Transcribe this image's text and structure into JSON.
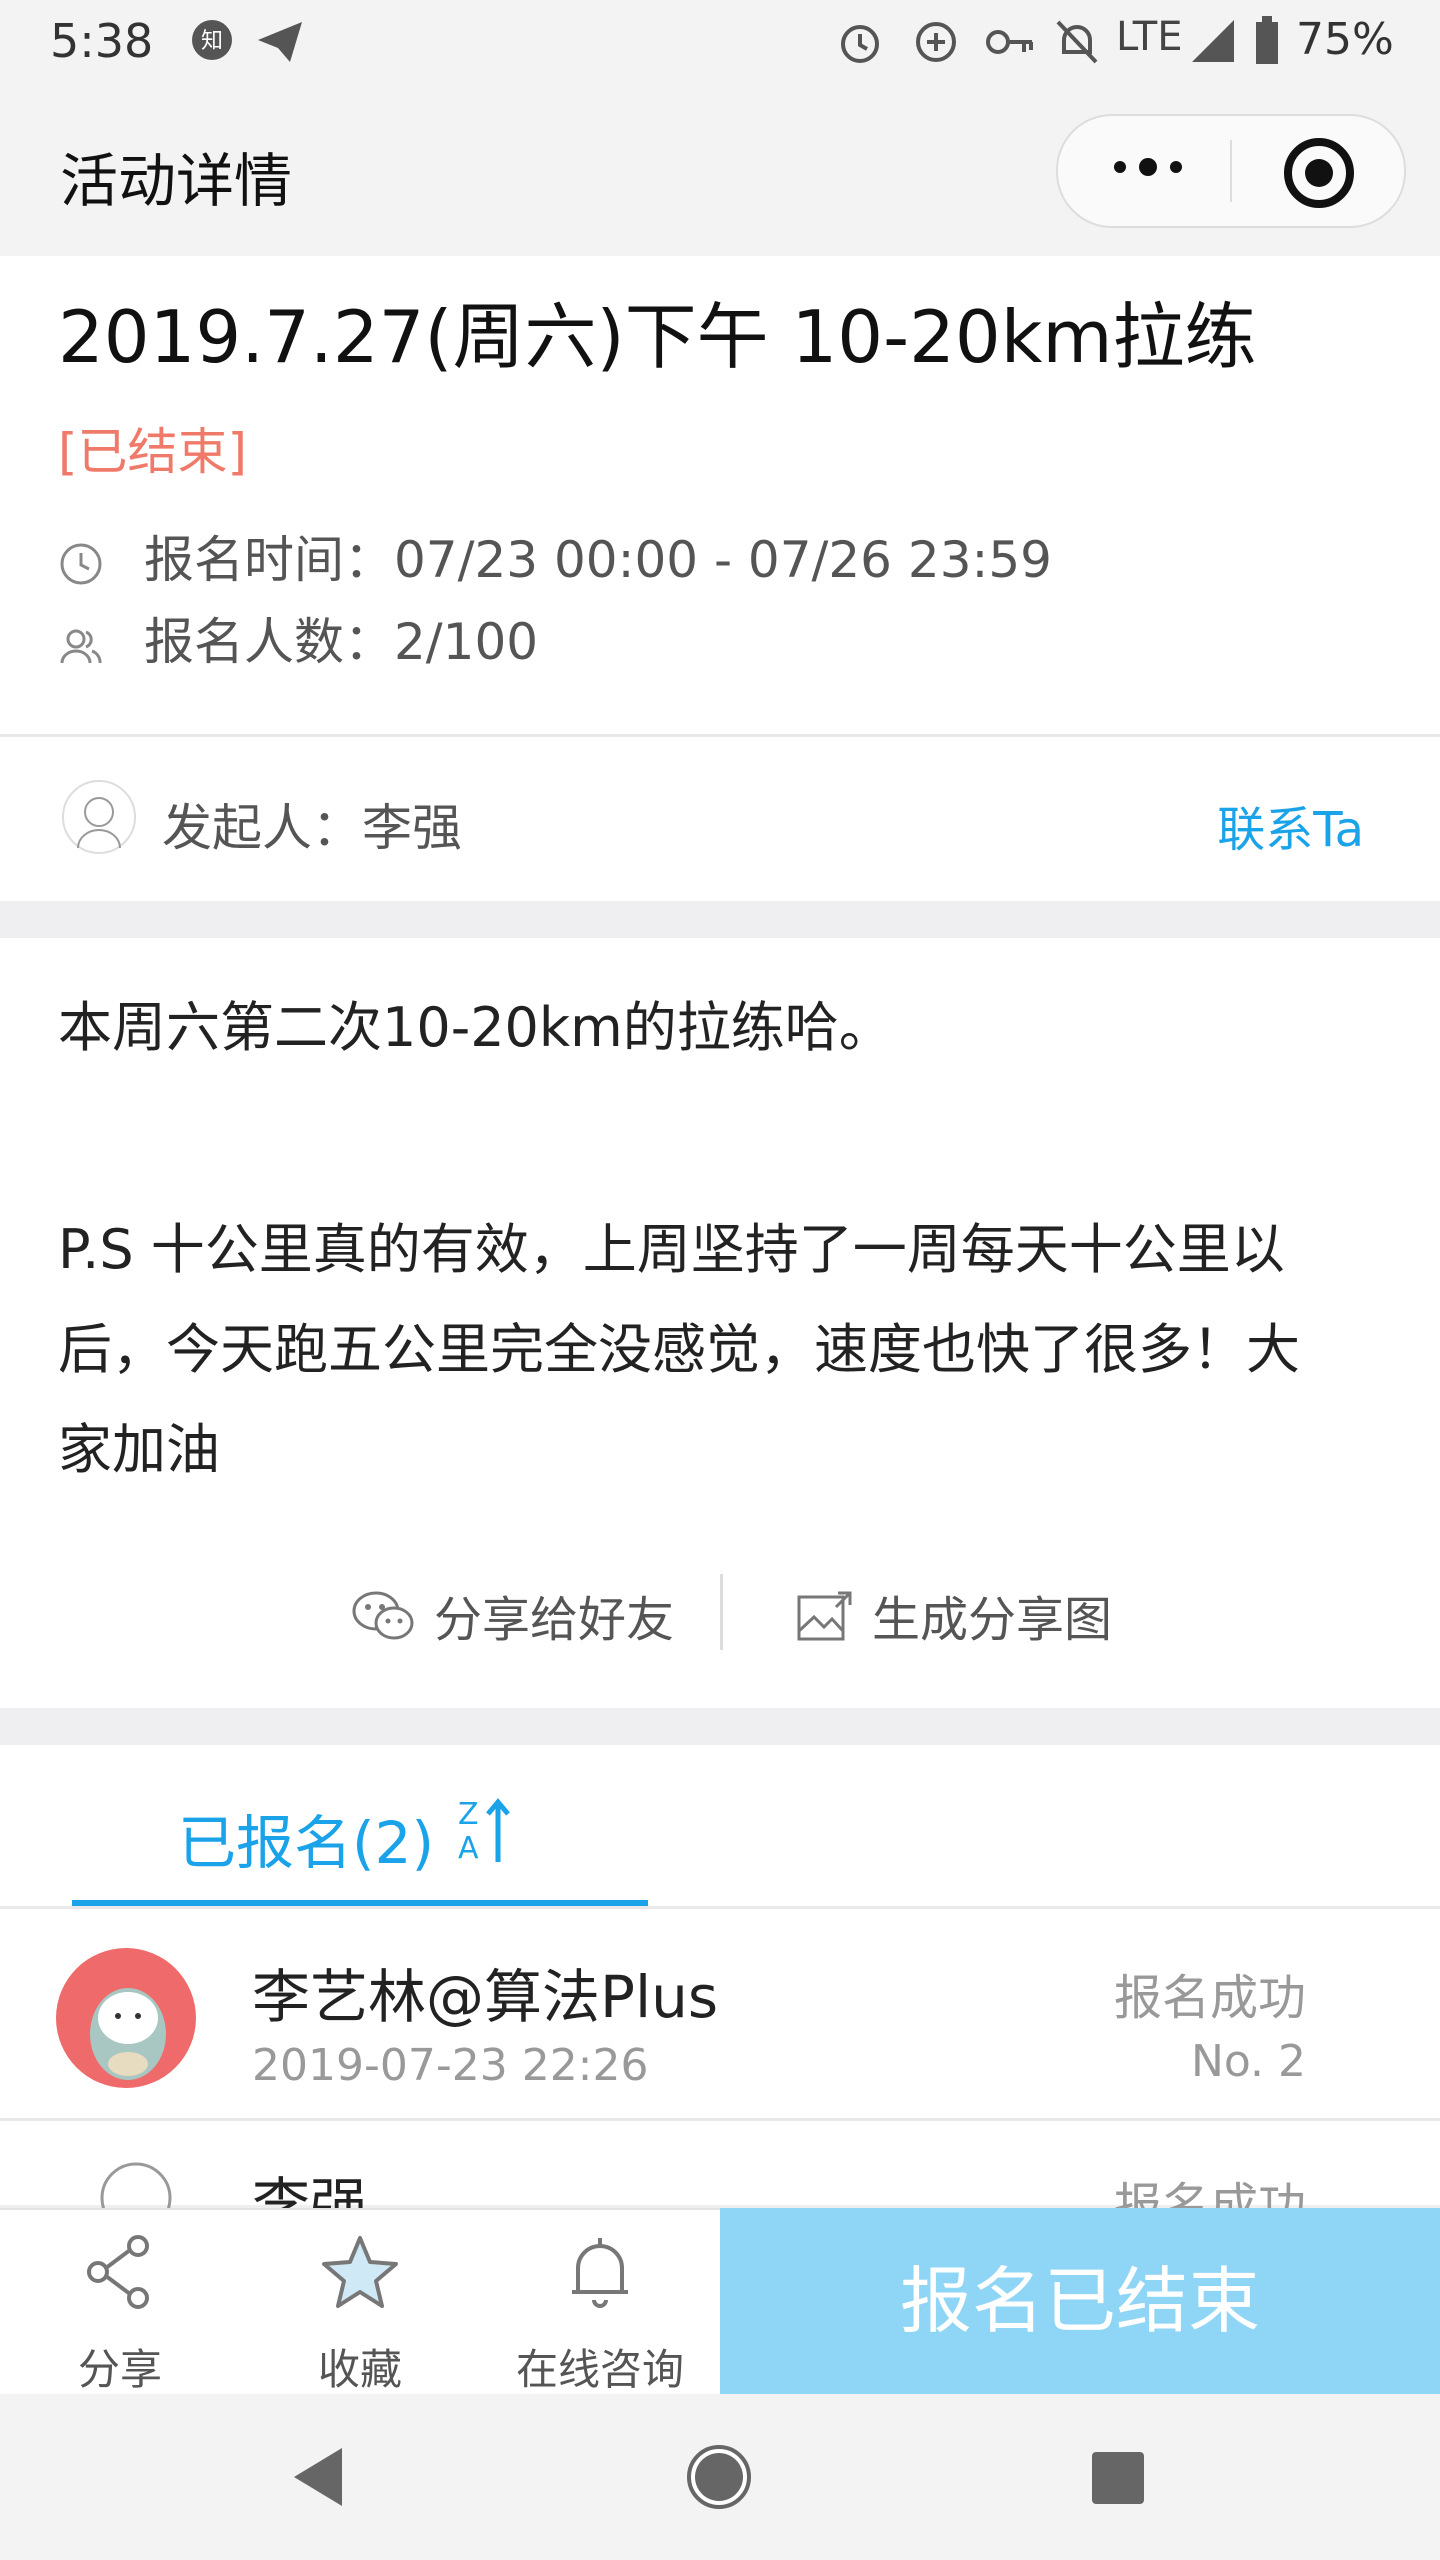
{
  "status_bar": {
    "time": "5:38",
    "network": "LTE",
    "battery": "75%"
  },
  "nav": {
    "title": "活动详情",
    "more_icon": "more-dots-icon",
    "target_icon": "target-icon"
  },
  "event": {
    "title": "2019.7.27(周六)下午 10-20km拉练",
    "status": "[已结束]",
    "signup_time": "报名时间：07/23 00:00 - 07/26 23:59",
    "signup_count": "报名人数：2/100"
  },
  "organizer": {
    "label": "发起人：李强",
    "contact": "联系Ta"
  },
  "description": {
    "line1": "本周六第二次10-20km的拉练哈。",
    "line2": "P.S 十公里真的有效，上周坚持了一周每天十公里以",
    "line3": "后，今天跑五公里完全没感觉，速度也快了很多！大",
    "line4": "家加油"
  },
  "share": {
    "friends": "分享给好友",
    "image": "生成分享图"
  },
  "tabs": {
    "registered": "已报名(2)",
    "sort_top": "Z",
    "sort_bottom": "A"
  },
  "participants": [
    {
      "name": "李艺林@算法Plus",
      "time": "2019-07-23 22:26",
      "status": "报名成功",
      "no": "No. 2"
    },
    {
      "name": "李强",
      "status": "报名成功"
    }
  ],
  "bottom": {
    "share": "分享",
    "favorite": "收藏",
    "consult": "在线咨询",
    "ended": "报名已结束"
  },
  "colors": {
    "accent": "#1aa3e8",
    "ended_tag": "#f07a6a",
    "ended_button": "#8fd6f6"
  }
}
